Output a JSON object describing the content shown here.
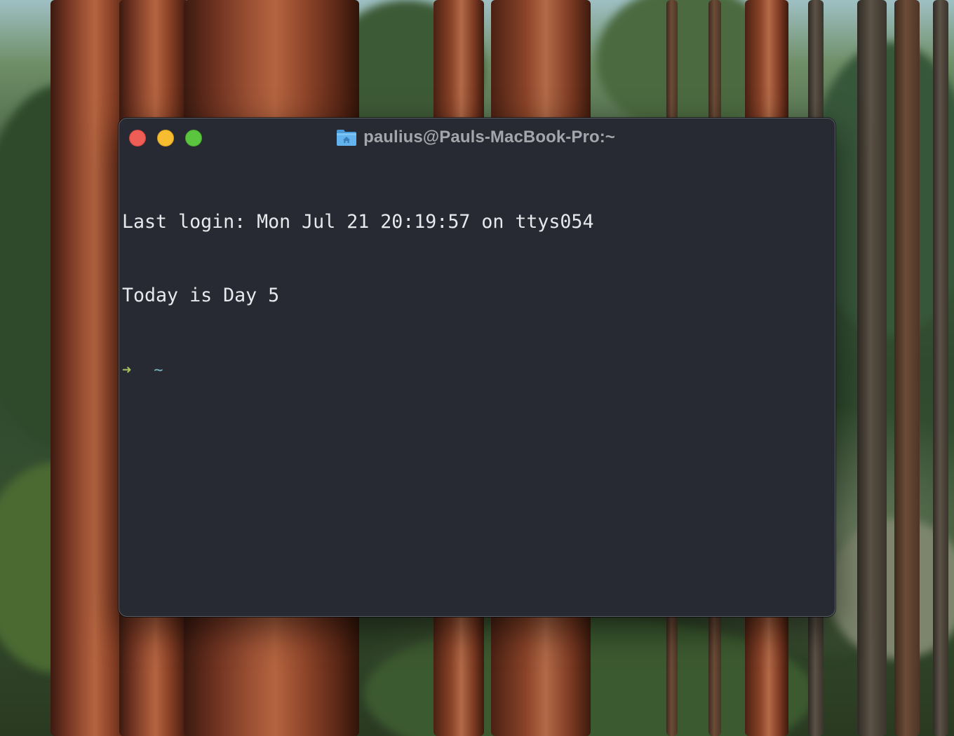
{
  "window": {
    "title": "paulius@Pauls-MacBook-Pro:~",
    "title_icon": "home-folder-icon"
  },
  "terminal": {
    "lines": [
      "Last login: Mon Jul 21 20:19:57 on ttys054",
      "Today is Day 5"
    ],
    "prompt": {
      "arrow": "➜",
      "cwd": "~"
    }
  },
  "colors": {
    "terminal_bg": "#282a33",
    "text": "#e8e9ec",
    "prompt_arrow": "#a8c35c",
    "prompt_cwd": "#79b8c0",
    "close": "#ee5e56",
    "minimize": "#f5bd2f",
    "maximize": "#5cc53f"
  }
}
